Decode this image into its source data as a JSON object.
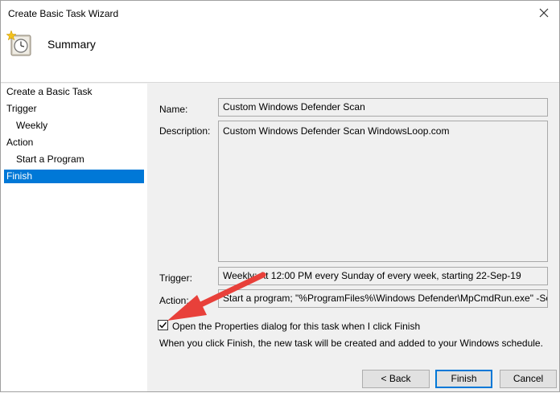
{
  "window": {
    "title": "Create Basic Task Wizard"
  },
  "header": {
    "title": "Summary",
    "icon": "task-scheduler-clock-icon"
  },
  "nav": {
    "items": [
      {
        "label": "Create a Basic Task"
      },
      {
        "label": "Trigger"
      },
      {
        "label": "Weekly"
      },
      {
        "label": "Action"
      },
      {
        "label": "Start a Program"
      },
      {
        "label": "Finish"
      }
    ],
    "selected": "Finish"
  },
  "form": {
    "name_label": "Name:",
    "name_value": "Custom Windows Defender Scan",
    "description_label": "Description:",
    "description_value": "Custom Windows Defender Scan WindowsLoop.com",
    "trigger_label": "Trigger:",
    "trigger_value": "Weekly; At 12:00 PM every Sunday of every week, starting 22-Sep-19",
    "action_label": "Action:",
    "action_value": "Start a program; \"%ProgramFiles%\\Windows Defender\\MpCmdRun.exe\" -Sc",
    "checkbox_label": "Open the Properties dialog for this task when I click Finish",
    "checkbox_checked": true,
    "info_text": "When you click Finish, the new task will be created and added to your Windows schedule."
  },
  "buttons": {
    "back": "< Back",
    "finish": "Finish",
    "cancel": "Cancel"
  },
  "colors": {
    "selection": "#0078d7",
    "annotation_arrow": "#e8403a"
  }
}
